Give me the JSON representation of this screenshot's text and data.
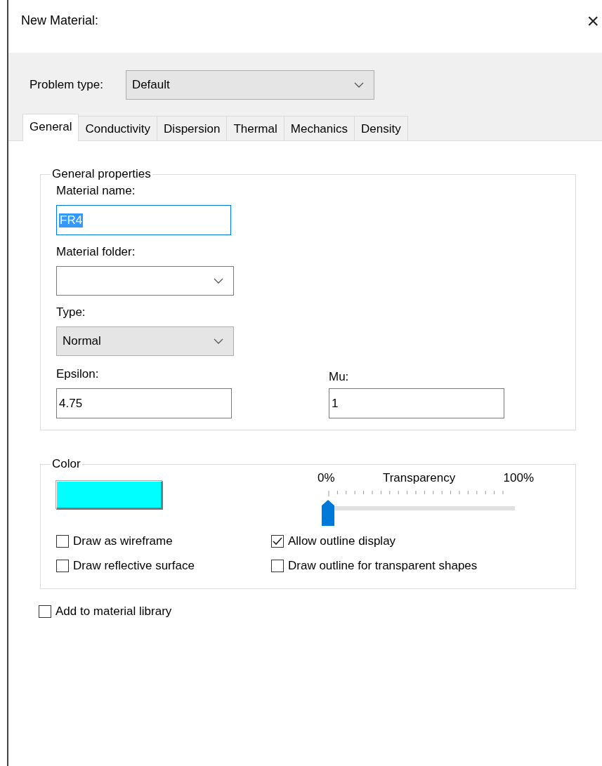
{
  "window": {
    "title": "New Material:",
    "close": "×"
  },
  "problem_type": {
    "label": "Problem type:",
    "value": "Default"
  },
  "tabs": [
    {
      "label": "General",
      "selected": true
    },
    {
      "label": "Conductivity",
      "selected": false
    },
    {
      "label": "Dispersion",
      "selected": false
    },
    {
      "label": "Thermal",
      "selected": false
    },
    {
      "label": "Mechanics",
      "selected": false
    },
    {
      "label": "Density",
      "selected": false
    }
  ],
  "general_properties": {
    "title": "General properties",
    "material_name": {
      "label": "Material name:",
      "value": "FR4",
      "selected": true
    },
    "material_folder": {
      "label": "Material folder:",
      "disabled": false
    },
    "type": {
      "label": "Type:",
      "value": "Normal",
      "disabled": true
    },
    "epsilon": {
      "label": "Epsilon:",
      "value": "4.75"
    },
    "mu": {
      "label": "Mu:",
      "value": "1"
    }
  },
  "color": {
    "title": "Color",
    "swatch": {
      "color": "#00ffff"
    },
    "transparency": {
      "min_label": "0%",
      "label": "Transparency",
      "max_label": "100%",
      "level": 0
    },
    "checkboxes": [
      {
        "label": "Draw as wireframe",
        "checked": false
      },
      {
        "label": "Allow outline display",
        "checked": true
      },
      {
        "label": "Draw reflective surface",
        "checked": false
      },
      {
        "label": "Draw outline for transparent shapes",
        "checked": false
      }
    ]
  },
  "add_to_library": {
    "label": "Add to material library",
    "checked": false
  }
}
